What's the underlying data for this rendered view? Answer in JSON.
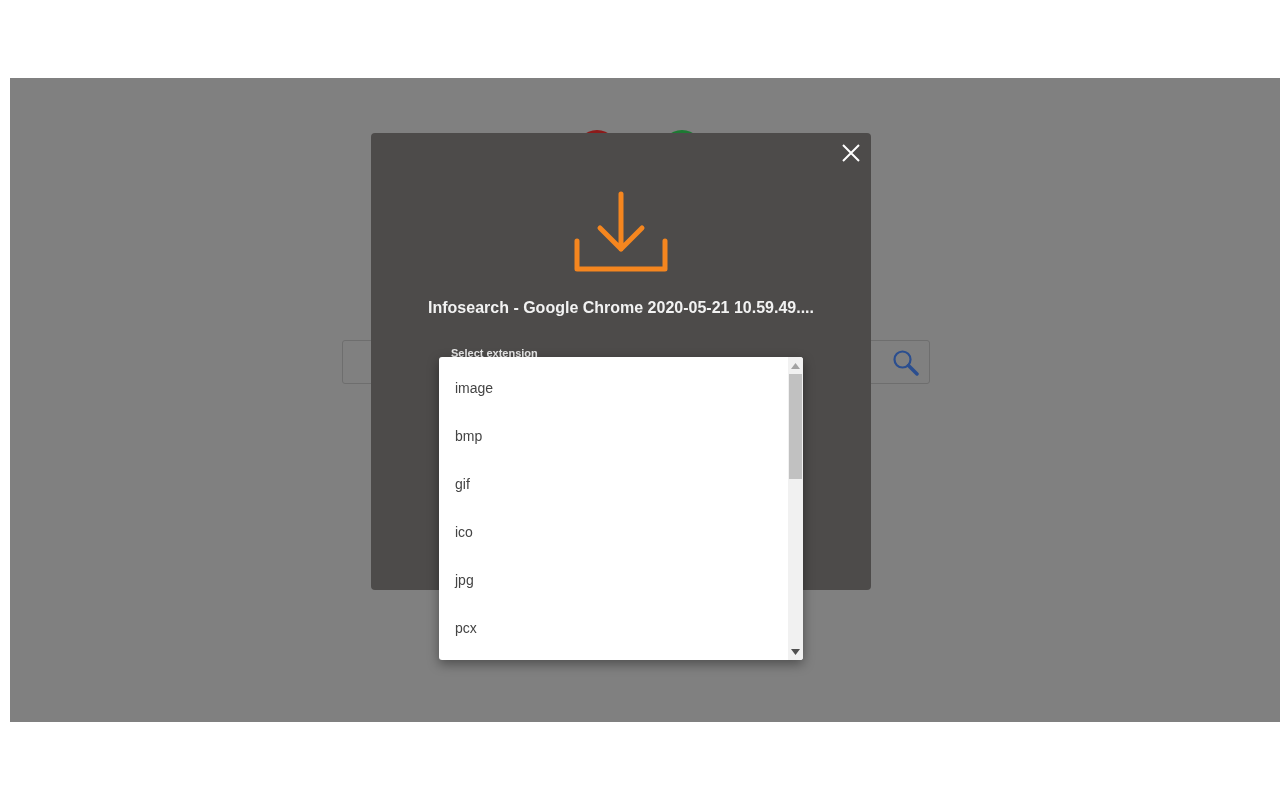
{
  "dialog": {
    "filename": "Infosearch - Google Chrome 2020-05-21 10.59.49....",
    "select": {
      "label": "Select extension"
    }
  },
  "dropdown": {
    "options": [
      {
        "label": "image"
      },
      {
        "label": "bmp"
      },
      {
        "label": "gif"
      },
      {
        "label": "ico"
      },
      {
        "label": "jpg"
      },
      {
        "label": "pcx"
      }
    ]
  }
}
